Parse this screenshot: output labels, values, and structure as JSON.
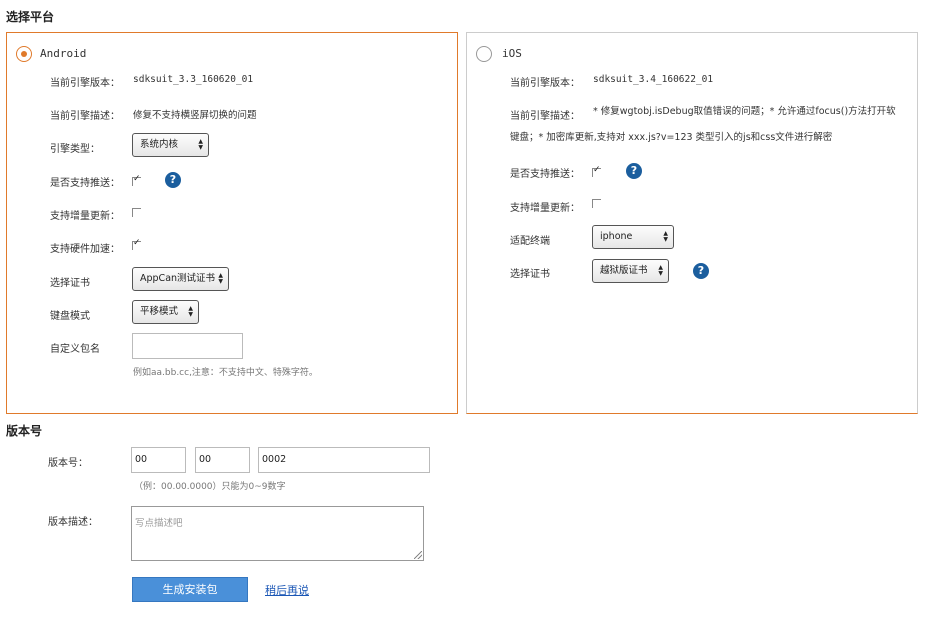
{
  "platform_section": {
    "title": "选择平台"
  },
  "android": {
    "name": "Android",
    "engine_version_label": "当前引擎版本：",
    "engine_version": "sdksuit_3.3_160620_01",
    "engine_desc_label": "当前引擎描述：",
    "engine_desc": "修复不支持横竖屏切换的问题",
    "engine_type_label": "引擎类型：",
    "engine_type": "系统内核",
    "push_label": "是否支持推送：",
    "push_checked": true,
    "incremental_label": "支持增量更新：",
    "incremental_checked": false,
    "hw_accel_label": "支持硬件加速：",
    "hw_accel_checked": true,
    "cert_label": "选择证书",
    "cert": "AppCan测试证书",
    "keyboard_label": "键盘模式",
    "keyboard": "平移模式",
    "package_label": "自定义包名",
    "package_value": "",
    "package_hint": "例如aa.bb.cc,注意：不支持中文、特殊字符。"
  },
  "ios": {
    "name": "iOS",
    "engine_version_label": "当前引擎版本：",
    "engine_version": "sdksuit_3.4_160622_01",
    "engine_desc_label": "当前引擎描述：",
    "engine_desc_line1": "* 修复wgtobj.isDebug取值错误的问题；* 允许通过focus()方法打开软",
    "engine_desc_line2": "键盘；* 加密库更新,支持对 xxx.js?v=123 类型引入的js和css文件进行解密",
    "push_label": "是否支持推送：",
    "push_checked": true,
    "incremental_label": "支持增量更新：",
    "incremental_checked": false,
    "device_label": "适配终端",
    "device": "iphone",
    "cert_label": "选择证书",
    "cert": "越狱版证书"
  },
  "version_section": {
    "title": "版本号",
    "version_label": "版本号：",
    "major": "00",
    "minor": "00",
    "build": "0002",
    "version_hint": "（例：00.00.0000）只能为0~9数字",
    "desc_label": "版本描述：",
    "desc_placeholder": "写点描述吧"
  },
  "actions": {
    "generate": "生成安装包",
    "later": "稍后再说"
  },
  "colors": {
    "accent": "#e07a2b",
    "primary_button": "#4a90d9",
    "help_icon": "#1b5e9e",
    "link": "#1a56b5"
  }
}
